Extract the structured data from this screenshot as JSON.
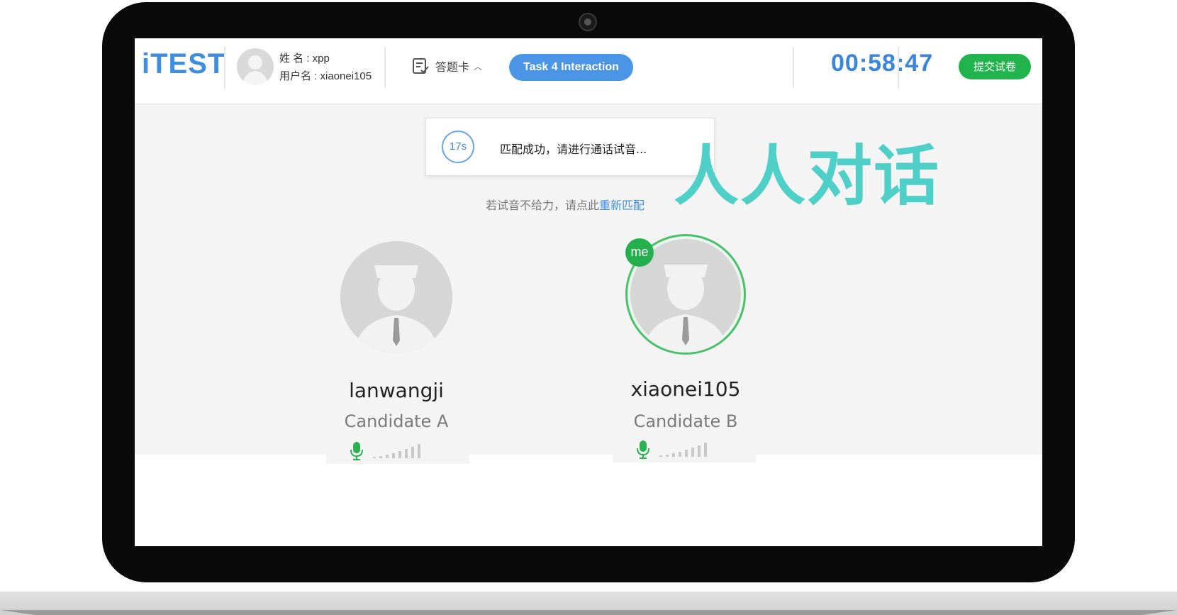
{
  "app": {
    "logo": "iTEST"
  },
  "user": {
    "name_line": "姓 名 : xpp",
    "username_line": "用户名 : xiaonei105"
  },
  "toolbar": {
    "answer_card_label": "答题卡",
    "task_label": "Task 4 Interaction",
    "timer": "00:58:47",
    "submit_label": "提交试卷"
  },
  "toast": {
    "countdown": "17s",
    "message": "匹配成功，请进行通话试音..."
  },
  "rematch": {
    "prefix": "若试音不给力，请点此",
    "link": "重新匹配"
  },
  "overlay": {
    "title": "人人对话"
  },
  "candidates": [
    {
      "username": "lanwangji",
      "role": "Candidate A"
    },
    {
      "username": "xiaonei105",
      "role": "Candidate B",
      "badge": "me"
    }
  ],
  "colors": {
    "accent": "#3d8ee0",
    "submit": "#21b34c",
    "me_badge": "#25b04e",
    "overlay": "#4ecfc7"
  }
}
